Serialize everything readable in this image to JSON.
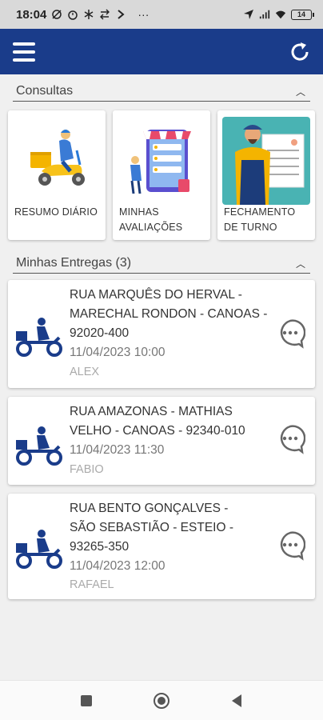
{
  "status_bar": {
    "time": "18:04",
    "dots": "···",
    "battery": "14"
  },
  "toolbar": {
    "menu_icon": "hamburger-menu-icon",
    "refresh_icon": "refresh-icon",
    "color": "#1a3c8a"
  },
  "consultas": {
    "title": "Consultas",
    "cards": [
      {
        "label_line1": "RESUMO DIÁRIO",
        "label_line2": "",
        "icon": "delivery-scooter-illustration"
      },
      {
        "label_line1": "MINHAS",
        "label_line2": "AVALIAÇÕES",
        "icon": "ratings-phone-illustration"
      },
      {
        "label_line1": "FECHAMENTO",
        "label_line2": "DE TURNO",
        "icon": "worker-checklist-illustration"
      }
    ]
  },
  "entregas": {
    "title": "Minhas Entregas (3)",
    "items": [
      {
        "addr1": "RUA MARQUÊS DO HERVAL -",
        "addr2": "MARECHAL RONDON - CANOAS -",
        "addr3": "92020-400",
        "datetime": "11/04/2023 10:00",
        "name": "ALEX"
      },
      {
        "addr1": "RUA AMAZONAS - MATHIAS",
        "addr2": "VELHO - CANOAS - 92340-010",
        "addr3": "",
        "datetime": "11/04/2023 11:30",
        "name": "FABIO"
      },
      {
        "addr1": "RUA BENTO GONÇALVES -",
        "addr2": "SÃO SEBASTIÃO - ESTEIO -",
        "addr3": "93265-350",
        "datetime": "11/04/2023 12:00",
        "name": "RAFAEL"
      }
    ]
  },
  "navbar": {
    "recent_icon": "recent-apps-icon",
    "home_icon": "home-icon",
    "back_icon": "back-icon"
  }
}
